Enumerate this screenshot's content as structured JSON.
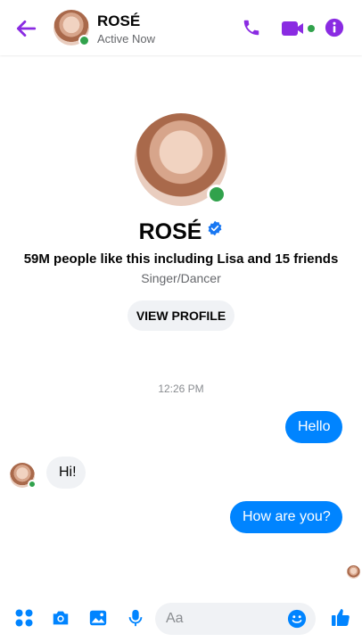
{
  "colors": {
    "accent_purple": "#8a2be2",
    "messenger_blue": "#0084ff",
    "active_green": "#31a24c",
    "bubble_gray": "#f0f2f5"
  },
  "header": {
    "name": "ROSÉ",
    "status": "Active Now",
    "icons": [
      "back-arrow-icon",
      "phone-icon",
      "video-camera-icon",
      "info-icon"
    ]
  },
  "profile": {
    "name": "ROSÉ",
    "likes": "59M people like this including Lisa and 15 friends",
    "role": "Singer/Dancer",
    "view_profile_label": "VIEW PROFILE"
  },
  "conversation": {
    "timestamp": "12:26 PM",
    "messages": [
      {
        "direction": "outgoing",
        "text": "Hello"
      },
      {
        "direction": "incoming",
        "text": "Hi!"
      },
      {
        "direction": "outgoing",
        "text": "How are you?"
      }
    ]
  },
  "composer": {
    "placeholder": "Aa",
    "icons": [
      "more-grid-icon",
      "camera-icon",
      "image-icon",
      "microphone-icon",
      "emoji-icon",
      "thumbs-up-icon"
    ]
  }
}
